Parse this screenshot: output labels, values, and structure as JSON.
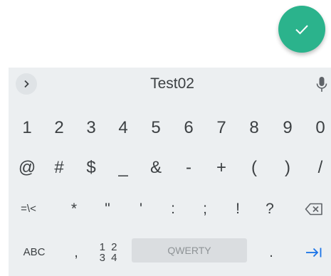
{
  "fab": {
    "icon": "check-icon",
    "color": "#2bb38c"
  },
  "suggestion_bar": {
    "expand_icon": "chevron-right-icon",
    "suggestion": "Test02",
    "mic_icon": "microphone-icon"
  },
  "keyboard": {
    "row1": [
      "1",
      "2",
      "3",
      "4",
      "5",
      "6",
      "7",
      "8",
      "9",
      "0"
    ],
    "row2": [
      "@",
      "#",
      "$",
      "_",
      "&",
      "-",
      "+",
      "(",
      ")",
      "/"
    ],
    "row3": [
      "=\\<",
      "*",
      "\"",
      "'",
      ":",
      ";",
      "!",
      "?"
    ],
    "row3_backspace_icon": "backspace-icon",
    "row4": {
      "abc": "ABC",
      "comma": ",",
      "num_top": "1 2",
      "num_bottom": "3 4",
      "space": "QWERTY",
      "period": ".",
      "enter_icon": "tab-next-icon",
      "accent": "#1a73e8"
    }
  }
}
